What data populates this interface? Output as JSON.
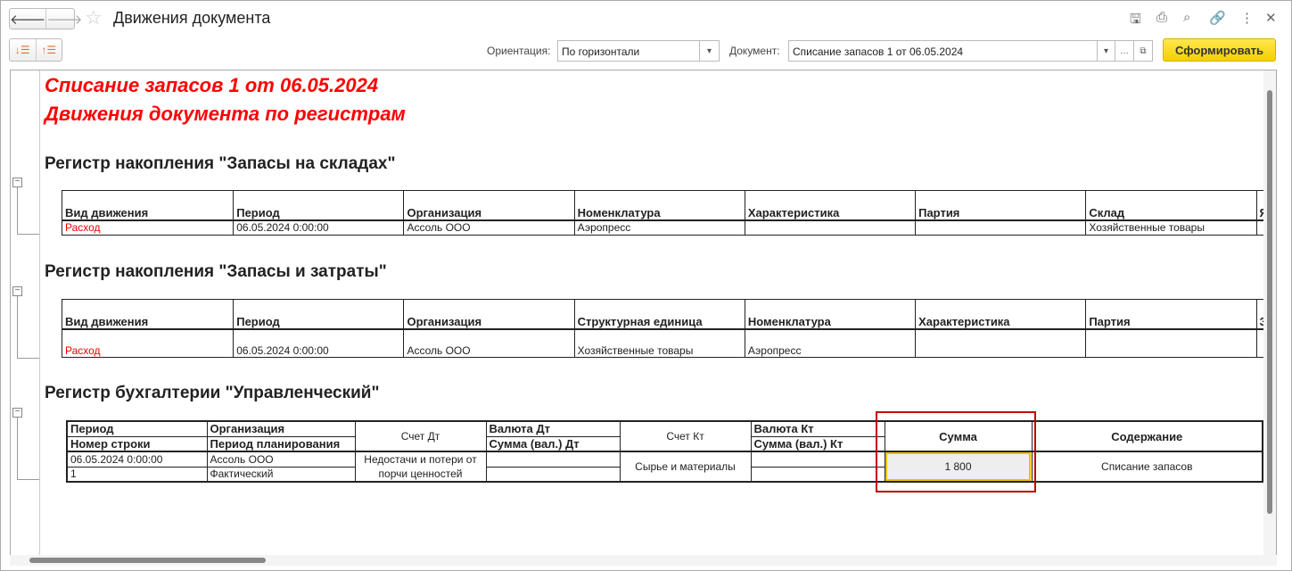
{
  "window": {
    "title": "Движения документа",
    "back": "🡐",
    "forward": "🡒"
  },
  "toolbar": {
    "orientation_label": "Ориентация:",
    "orientation_value": "По горизонтали",
    "document_label": "Документ:",
    "document_value": "Списание запасов 1 от 06.05.2024",
    "generate": "Сформировать"
  },
  "report": {
    "title1": "Списание запасов 1 от 06.05.2024",
    "title2": "Движения документа по регистрам",
    "reg1": {
      "title": "Регистр накопления \"Запасы на складах\"",
      "headers": [
        "Вид движения",
        "Период",
        "Организация",
        "Номенклатура",
        "Характеристика",
        "Партия",
        "Склад",
        "Яч"
      ],
      "row": [
        "Расход",
        "06.05.2024 0:00:00",
        "Ассоль ООО",
        "Аэропресс",
        "",
        "",
        "Хозяйственные товары",
        ""
      ]
    },
    "reg2": {
      "title": "Регистр накопления \"Запасы и затраты\"",
      "headers": [
        "Вид движения",
        "Период",
        "Организация",
        "Структурная единица",
        "Номенклатура",
        "Характеристика",
        "Партия",
        "За"
      ],
      "row": [
        "Расход",
        "06.05.2024 0:00:00",
        "Ассоль ООО",
        "Хозяйственные товары",
        "Аэропресс",
        "",
        "",
        ""
      ]
    },
    "reg3": {
      "title": "Регистр бухгалтерии \"Управленческий\"",
      "h_period": "Период",
      "h_line": "Номер строки",
      "h_org": "Организация",
      "h_plan": "Период планирования",
      "h_dt": "Счет Дт",
      "h_cur_dt": "Валюта Дт",
      "h_sum_dt": "Сумма (вал.) Дт",
      "h_kt": "Счет Кт",
      "h_cur_kt": "Валюта Кт",
      "h_sum_kt": "Сумма (вал.) Кт",
      "h_sum": "Сумма",
      "h_content": "Содержание",
      "period": "06.05.2024 0:00:00",
      "line": "1",
      "org": "Ассоль ООО",
      "plan": "Фактический",
      "dt": "Недостачи и потери от порчи ценностей",
      "kt": "Сырье и материалы",
      "sum": "1 800",
      "content": "Списание запасов"
    }
  },
  "colors": {
    "highlight": "#c00000",
    "accent": "#f5cf00",
    "movement": "#e00000"
  }
}
